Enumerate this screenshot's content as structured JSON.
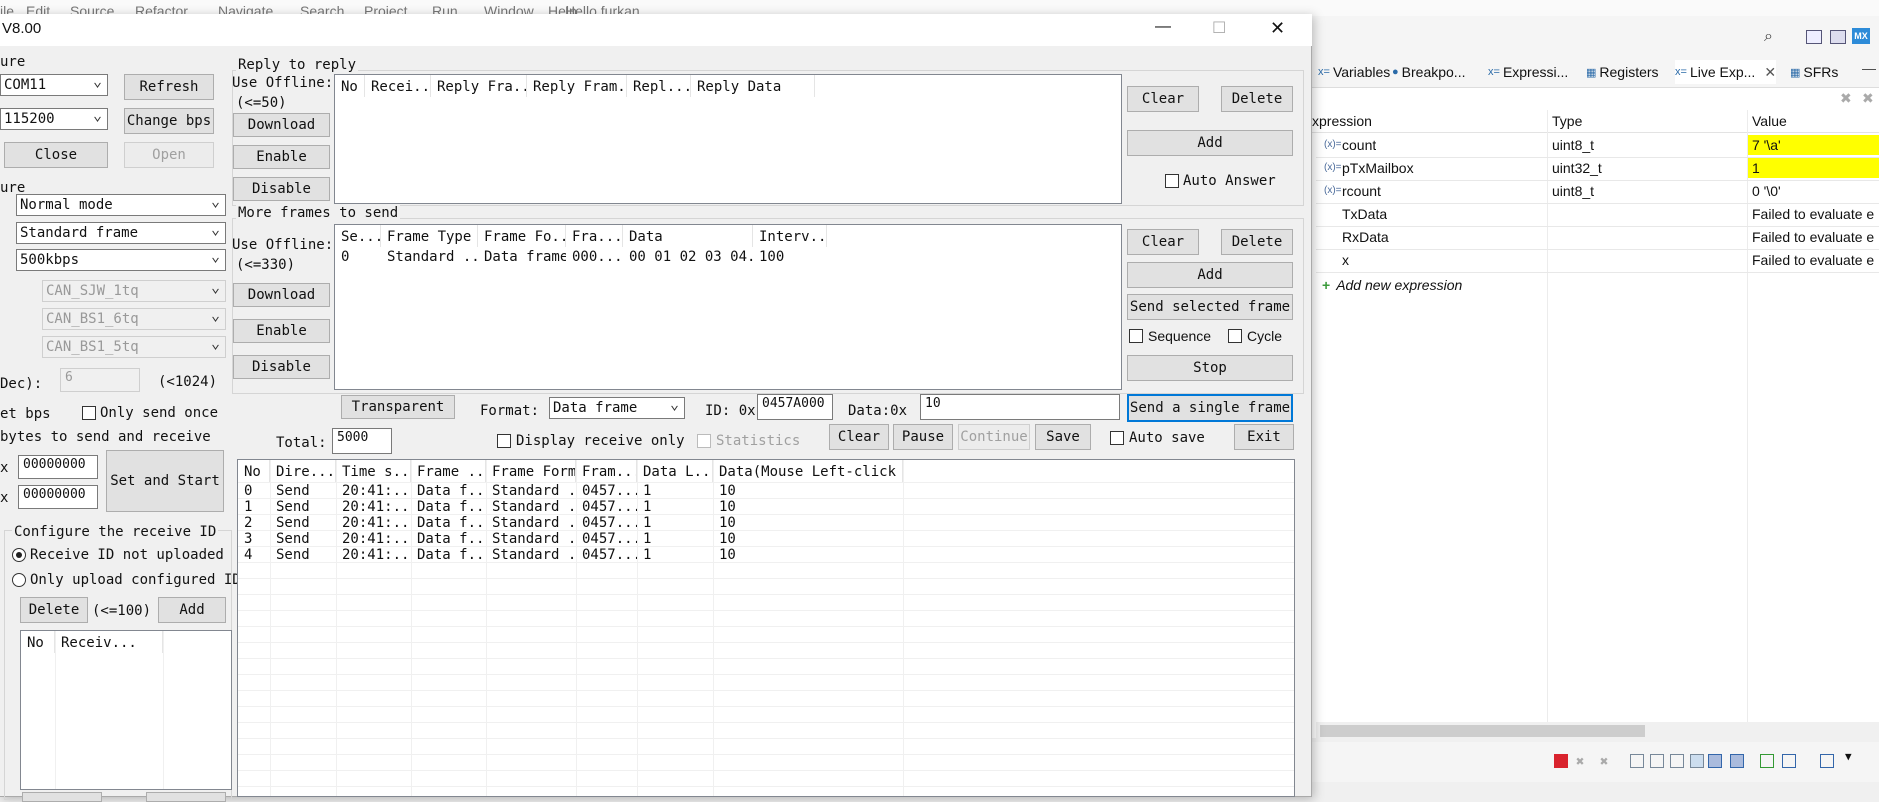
{
  "ide_menu": [
    "ile",
    "Edit",
    "Source",
    "Refactor",
    "Navigate",
    "Search",
    "Project",
    "Run",
    "Window",
    "Help"
  ],
  "ide_user": "Hello furkan",
  "ide_toolbar_badge": "MX",
  "ide_tabs": [
    "Variables",
    "Breakpo...",
    "Expressi...",
    "Registers",
    "Live Exp...",
    "SFRs"
  ],
  "ide_tab_close": "✕",
  "expr_headers": [
    "xpression",
    "Type",
    "Value"
  ],
  "expr_rows": [
    {
      "name": "count",
      "type": "uint8_t",
      "value": "7 '\\a'",
      "highlight": true,
      "icon": "(x)="
    },
    {
      "name": "pTxMailbox",
      "type": "uint32_t",
      "value": "1",
      "highlight": true,
      "icon": "(x)="
    },
    {
      "name": "rcount",
      "type": "uint8_t",
      "value": "0 '\\0'",
      "highlight": false,
      "icon": "(x)="
    },
    {
      "name": "TxData",
      "type": "",
      "value": "Failed to evaluate e",
      "highlight": false,
      "icon": ""
    },
    {
      "name": "RxData",
      "type": "",
      "value": "Failed to evaluate e",
      "highlight": false,
      "icon": ""
    },
    {
      "name": "x",
      "type": "",
      "value": "Failed to evaluate e",
      "highlight": false,
      "icon": ""
    }
  ],
  "expr_add_label": "Add new expression",
  "expr_add_icon": "+",
  "highlight_color": "#ffff00",
  "win_title": "V8.00",
  "win_controls": {
    "minimize": "—",
    "maximize": "☐",
    "close": "✕"
  },
  "left": {
    "section1": "ure",
    "port": "COM11",
    "baud": "115200",
    "refresh": "Refresh",
    "change_bps": "Change bps",
    "close": "Close",
    "open": "Open",
    "section2": "ure",
    "mode": "Normal mode",
    "frame": "Standard frame",
    "rate": "500kbps",
    "sjw": "CAN_SJW_1tq",
    "bs1": "CAN_BS1_6tq",
    "bs2": "CAN_BS1_5tq",
    "dec_label": "Dec):",
    "dec_value": "6",
    "dec_limit": "(<1024)",
    "set_bps": "et bps",
    "only_send_once": "Only send once",
    "bytes_label": " bytes to send and receive",
    "x1_label": "x",
    "x1_value": "00000000",
    "x2_label": "x",
    "x2_value": "00000000",
    "set_start": "Set and Start",
    "recv_id_group": "Configure the receive ID",
    "recv_not_uploaded": "Receive ID not uploaded",
    "recv_only_configured": "Only upload configured ID",
    "delete": "Delete",
    "limit100": "(<=100)",
    "add": "Add",
    "list_headers": [
      "No",
      "Receiv..."
    ]
  },
  "reply": {
    "group": "Reply to reply",
    "use_offline": "Use Offline:",
    "limit": "(<=50)",
    "download": "Download",
    "enable": "Enable",
    "disable": "Disable",
    "headers": [
      "No",
      "Recei...",
      "Reply Fra...",
      "Reply Fram...",
      "Repl...",
      "Reply Data"
    ],
    "clear": "Clear",
    "delete": "Delete",
    "add": "Add",
    "auto_answer": "Auto Answer"
  },
  "more": {
    "group": "More frames to send",
    "use_offline": "Use Offline:",
    "limit": "(<=330)",
    "download": "Download",
    "enable": "Enable",
    "disable": "Disable",
    "headers": [
      "Se...",
      "Frame Type",
      "Frame Fo...",
      "Fra...",
      "Data",
      "Interv..."
    ],
    "rows": [
      [
        "0",
        "Standard ...",
        "Data frame",
        "000...",
        "00 01 02 03 04...",
        "100"
      ]
    ],
    "clear": "Clear",
    "delete": "Delete",
    "add": "Add",
    "send_selected": "Send selected frame",
    "sequence": "Sequence",
    "cycle": "Cycle",
    "stop": "Stop"
  },
  "single": {
    "transparent": "Transparent",
    "format_label": "Format:",
    "format_value": "Data frame",
    "id_label": "ID: 0x",
    "id_value": "0457A000",
    "data_label": "Data:0x",
    "data_value": "10",
    "send_single": "Send a single frame",
    "total_label": "Total:",
    "total_value": "5000",
    "display_receive_only": "Display receive only",
    "statistics": "Statistics",
    "clear": "Clear",
    "pause": "Pause",
    "continue": "Continue",
    "save": "Save",
    "auto_save": "Auto save",
    "exit": "Exit"
  },
  "log": {
    "headers": [
      "No",
      "Dire...",
      "Time s...",
      "Frame ...",
      "Frame Format",
      "Fram...",
      "Data L...",
      "Data(Mouse Left-click He..."
    ],
    "rows": [
      [
        "0",
        "Send",
        "20:41:...",
        "Data f...",
        "Standard ...",
        "0457...",
        "1",
        "10"
      ],
      [
        "1",
        "Send",
        "20:41:...",
        "Data f...",
        "Standard ...",
        "0457...",
        "1",
        "10"
      ],
      [
        "2",
        "Send",
        "20:41:...",
        "Data f...",
        "Standard ...",
        "0457...",
        "1",
        "10"
      ],
      [
        "3",
        "Send",
        "20:41:...",
        "Data f...",
        "Standard ...",
        "0457...",
        "1",
        "10"
      ],
      [
        "4",
        "Send",
        "20:41:...",
        "Data f...",
        "Standard ...",
        "0457...",
        "1",
        "10"
      ]
    ]
  }
}
